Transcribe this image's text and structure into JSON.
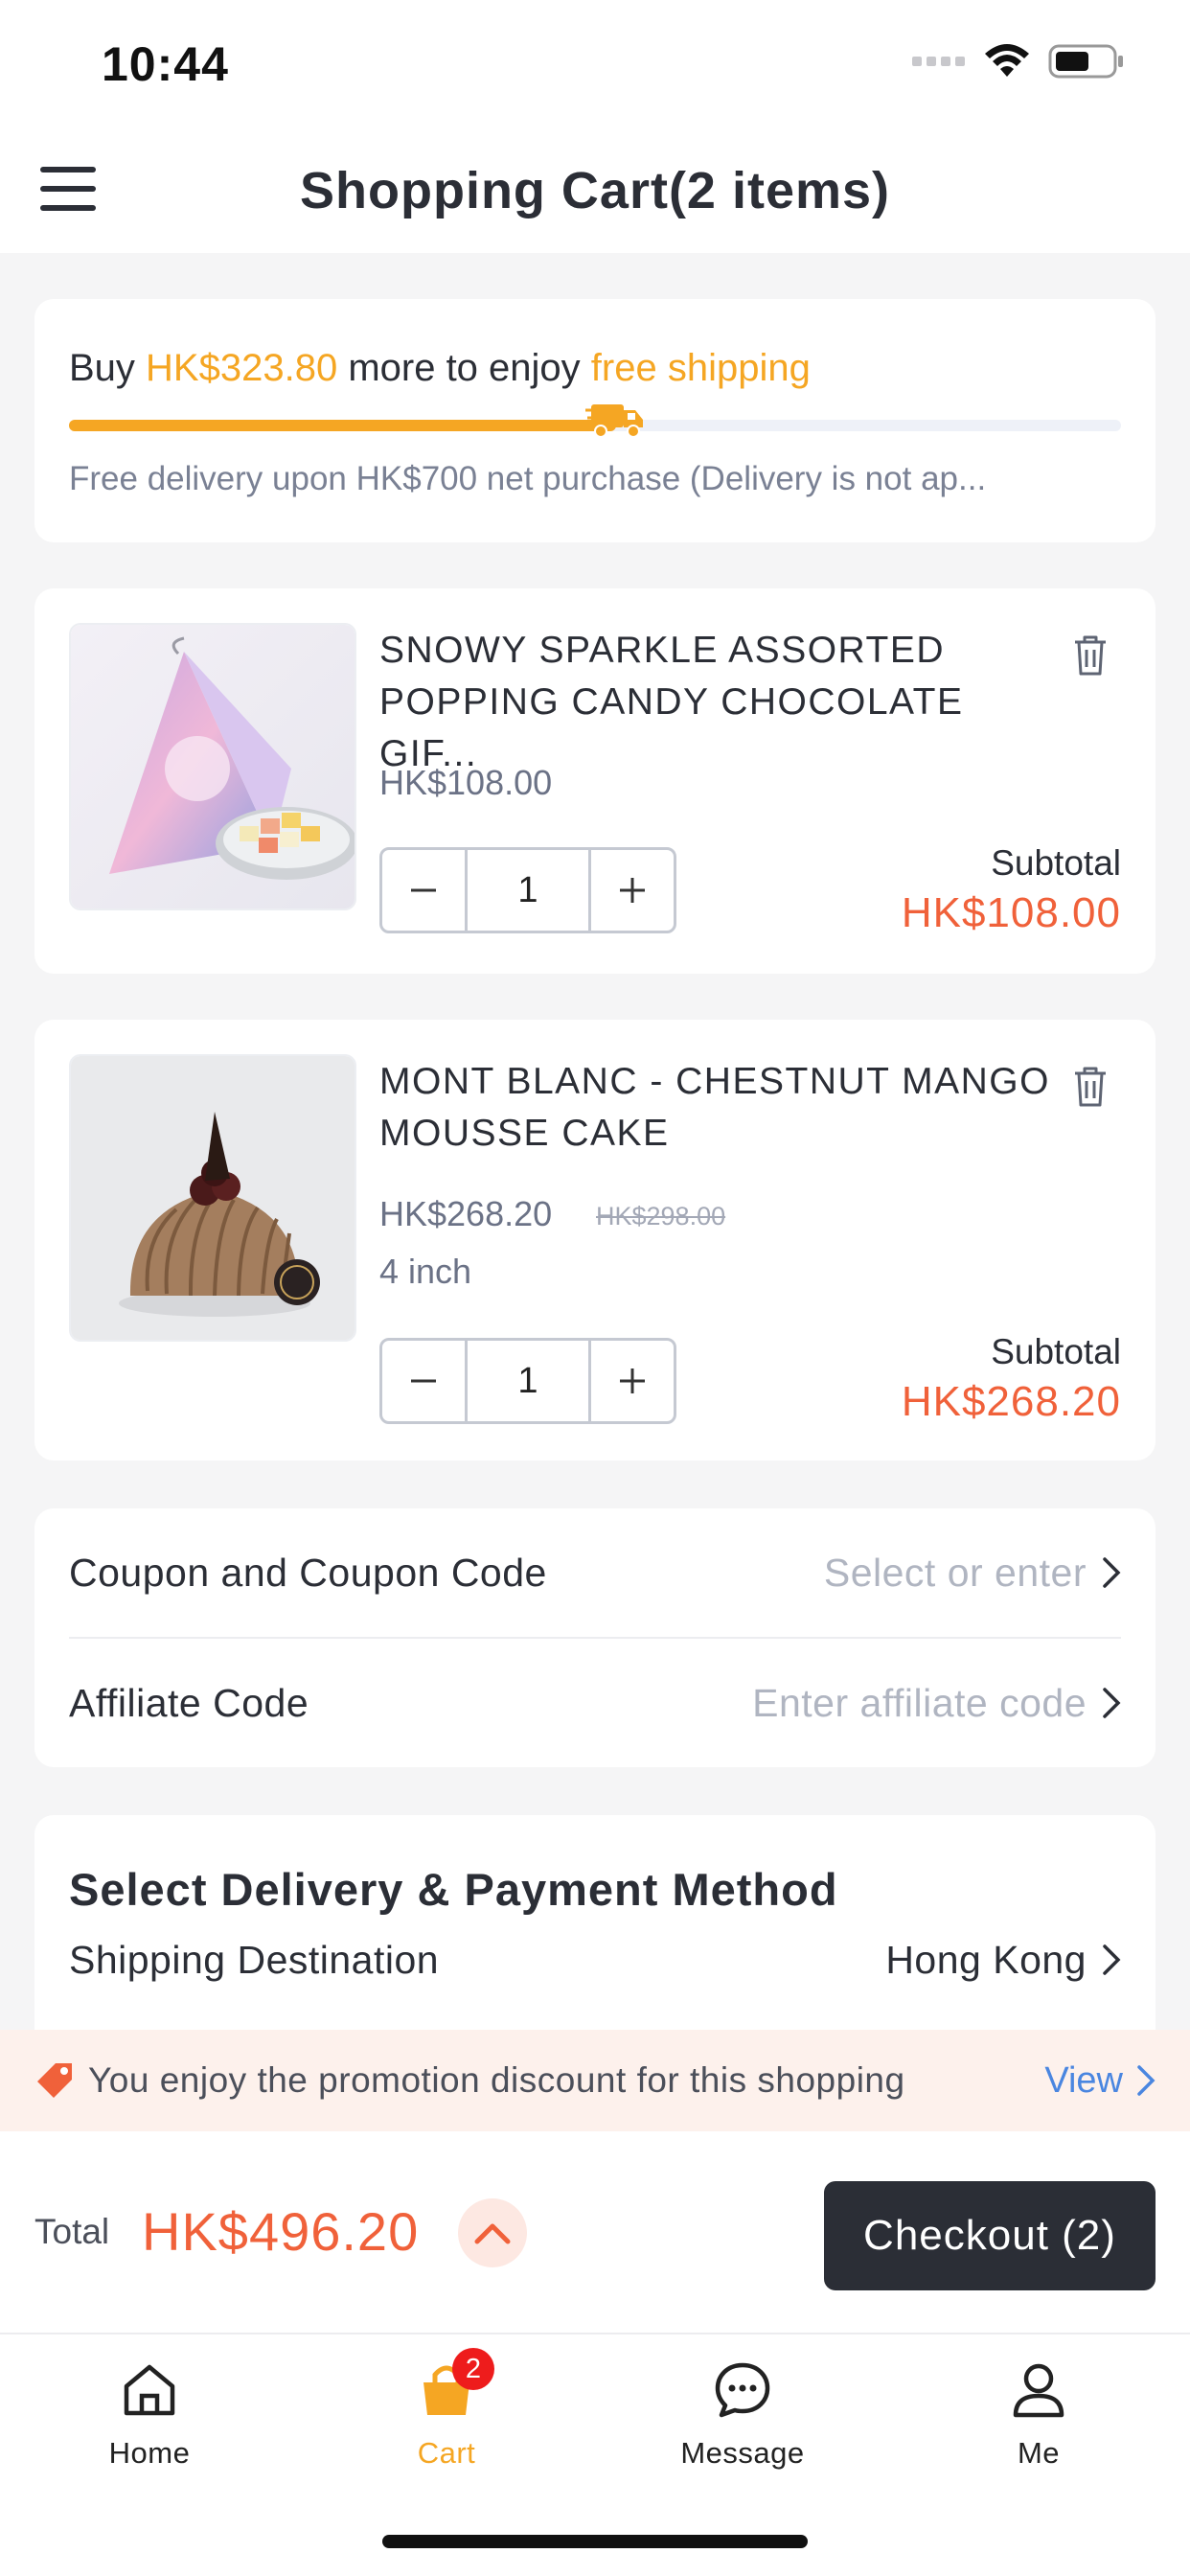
{
  "status": {
    "time": "10:44"
  },
  "nav": {
    "title": "Shopping Cart(2 items)"
  },
  "shipping": {
    "prefix": "Buy ",
    "amount": "HK$323.80",
    "middle": " more to enjoy ",
    "free": "free shipping",
    "progress": 0.52,
    "note": "Free delivery upon HK$700 net purchase (Delivery is not ap..."
  },
  "cart": {
    "items": [
      {
        "name": "SNOWY SPARKLE ASSORTED POPPING CANDY CHOCOLATE GIF...",
        "price": "HK$108.00",
        "quantity": "1",
        "subtotal_label": "Subtotal",
        "subtotal": "HK$108.00"
      },
      {
        "name": "MONT BLANC - CHESTNUT MANGO MOUSSE CAKE",
        "price": "HK$268.20",
        "old_price": "HK$298.00",
        "variant": "4 inch",
        "quantity": "1",
        "subtotal_label": "Subtotal",
        "subtotal": "HK$268.20"
      }
    ]
  },
  "codes": {
    "coupon_label": "Coupon and Coupon Code",
    "coupon_placeholder": "Select or enter",
    "affiliate_label": "Affiliate Code",
    "affiliate_placeholder": "Enter affiliate code"
  },
  "delivery": {
    "title": "Select Delivery & Payment Method",
    "destination_label": "Shipping Destination",
    "destination_value": "Hong Kong"
  },
  "promo": {
    "text": "You enjoy the promotion discount for this shopping",
    "view": "View"
  },
  "checkout": {
    "total_label": "Total",
    "total": "HK$496.20",
    "button": "Checkout (2)"
  },
  "tabs": [
    {
      "label": "Home",
      "icon": "home-icon"
    },
    {
      "label": "Cart",
      "icon": "cart-icon",
      "badge": "2",
      "active": true
    },
    {
      "label": "Message",
      "icon": "message-icon"
    },
    {
      "label": "Me",
      "icon": "person-icon"
    }
  ],
  "colors": {
    "accent_orange": "#f5a623",
    "price_red": "#f0613a",
    "link_blue": "#4a86e0",
    "dark": "#2b2e36",
    "badge_red": "#ee1c1c"
  }
}
